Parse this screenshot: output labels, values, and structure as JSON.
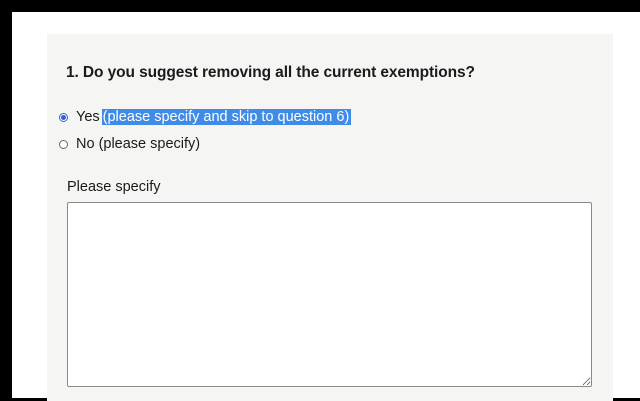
{
  "question": {
    "title": "1. Do you suggest removing all the current exemptions?"
  },
  "options": [
    {
      "label": "Yes",
      "suffix_selected_text": "(please specify and skip to question 6)",
      "checked": true
    },
    {
      "label": "No (please specify)",
      "checked": false
    }
  ],
  "specify": {
    "label": "Please specify",
    "value": ""
  },
  "colors": {
    "panel_background": "#f5f5f4",
    "selection_highlight": "#3f8ce8",
    "radio_checked": "#2a66d4",
    "frame": "#000000"
  }
}
